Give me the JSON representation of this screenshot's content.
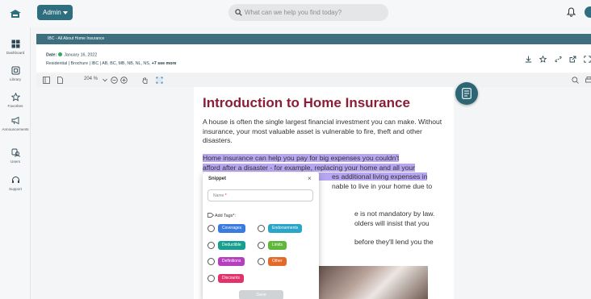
{
  "header": {
    "admin_label": "Admin",
    "search_placeholder": "What can we help you find today?"
  },
  "sidebar": {
    "items": [
      {
        "label": "Dashboard",
        "icon": "dashboard-icon"
      },
      {
        "label": "Library",
        "icon": "library-icon"
      },
      {
        "label": "Favorites",
        "icon": "star-icon"
      },
      {
        "label": "Announcements",
        "icon": "megaphone-icon"
      },
      {
        "label": "Users",
        "icon": "users-icon"
      },
      {
        "label": "Support",
        "icon": "headset-icon"
      }
    ]
  },
  "document": {
    "banner_title": "IBC - All About Home Insurance",
    "date_label": "Date:",
    "date_value": "January 16, 2022",
    "tags_text": "Residential | Brochure | IBC | AB, BC, MB, NB, NL, NS,",
    "tags_more": "+7 see more",
    "zoom": "204 %",
    "status_color": "#2eab5e"
  },
  "page": {
    "title": "Introduction to Home Insurance",
    "para1": "A house is often the single largest financial investment you can make. Without insurance, your most valuable asset is vulnerable to fire, theft and other disasters.",
    "para2_line1": "Home insurance can help you pay for big expenses you couldn't",
    "para2_line2": "afford after a disaster - for example, replacing your home and all your",
    "para2_line3_end": "es additional living expenses in",
    "para2_line4_end": "nable to live in your home due to",
    "para3_line1_end": "e is not mandatory by law.",
    "para3_line2_end": "olders will insist that you purchase",
    "para3_line3_end": "before they'll lend you the money"
  },
  "snippet": {
    "title": "Snippet",
    "close": "×",
    "name_placeholder": "Name",
    "required_mark": "*",
    "tags_label": "Add Tags",
    "tags_required": "*:",
    "save_label": "Save",
    "tags": [
      {
        "label": "Coverages",
        "color": "#3a7be0"
      },
      {
        "label": "Endorsements",
        "color": "#2ba6c9"
      },
      {
        "label": "Deductible",
        "color": "#17a08f"
      },
      {
        "label": "Limits",
        "color": "#5fb83a"
      },
      {
        "label": "Definitions",
        "color": "#b43fbf"
      },
      {
        "label": "Other",
        "color": "#e26b2a"
      },
      {
        "label": "Discounts",
        "color": "#e0336b"
      }
    ]
  },
  "colors": {
    "brand": "#2f6e7f",
    "title": "#8c1d38",
    "highlight": "#b7a6f2"
  }
}
